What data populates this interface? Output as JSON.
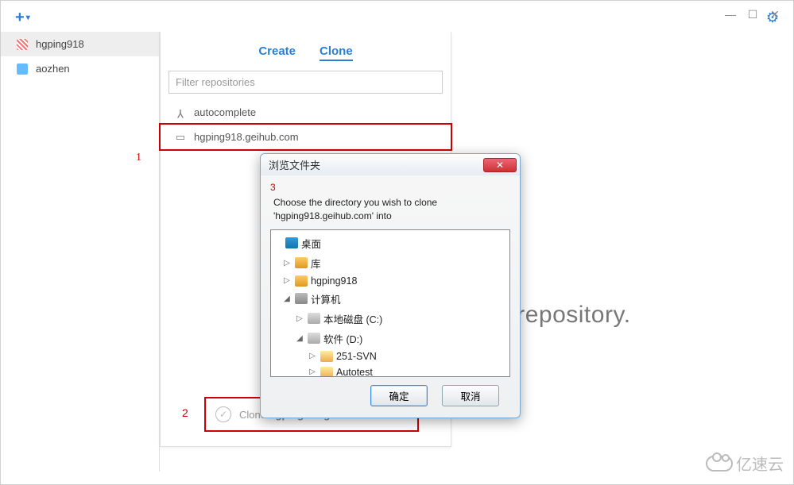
{
  "window_controls": {
    "min": "—",
    "max": "☐",
    "close": "✕"
  },
  "toolbar": {
    "plus": "+",
    "gear": "⚙"
  },
  "sidebar": {
    "items": [
      {
        "label": "hgping918"
      },
      {
        "label": "aozhen"
      }
    ]
  },
  "panel": {
    "tabs": {
      "create": "Create",
      "clone": "Clone"
    },
    "filter_placeholder": "Filter repositories",
    "repos": [
      {
        "label": "autocomplete"
      },
      {
        "label": "hgping918.geihub.com"
      }
    ],
    "footer": {
      "prefix": "Clone ",
      "repo": "hgping918.geihub.com"
    }
  },
  "markers": {
    "m1": "1",
    "m2": "2",
    "m3": "3"
  },
  "big_text": "ng a repository.",
  "dialog": {
    "title": "浏览文件夹",
    "message_l1": "Choose the directory you wish to clone",
    "message_l2": "'hgping918.geihub.com' into",
    "tree": [
      {
        "indent": 0,
        "twisty": "",
        "icon": "ico-desktop",
        "label": "桌面"
      },
      {
        "indent": 1,
        "twisty": "▷",
        "icon": "ico-lib",
        "label": "库"
      },
      {
        "indent": 1,
        "twisty": "▷",
        "icon": "ico-user",
        "label": "hgping918"
      },
      {
        "indent": 1,
        "twisty": "◢",
        "icon": "ico-computer",
        "label": "计算机"
      },
      {
        "indent": 2,
        "twisty": "▷",
        "icon": "ico-drive",
        "label": "本地磁盘 (C:)"
      },
      {
        "indent": 2,
        "twisty": "◢",
        "icon": "ico-drive",
        "label": "软件 (D:)"
      },
      {
        "indent": 3,
        "twisty": "▷",
        "icon": "ico-folder",
        "label": "251-SVN"
      },
      {
        "indent": 3,
        "twisty": "▷",
        "icon": "ico-folder",
        "label": "Autotest"
      }
    ],
    "ok": "确定",
    "cancel": "取消"
  },
  "watermark": "亿速云"
}
